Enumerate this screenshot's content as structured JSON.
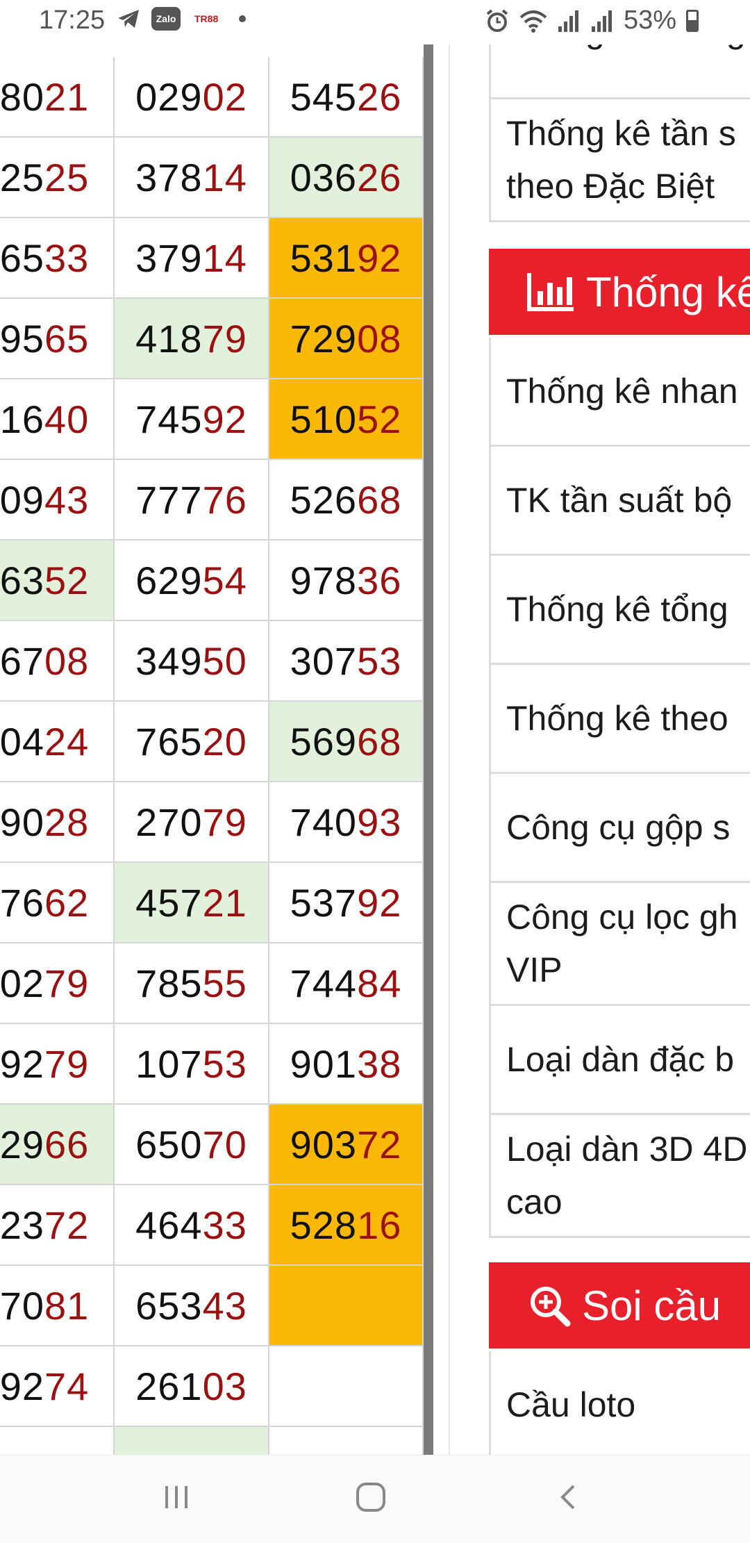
{
  "status_bar": {
    "time": "17:25",
    "left_icons": [
      "telegram-icon",
      "zalo-icon",
      "tr88-icon"
    ],
    "zalo_label": "Zalo",
    "tr88_label": "TR88",
    "battery": "53%"
  },
  "table": {
    "rows": [
      [
        {
          "head": "80",
          "tail": "21",
          "bg": ""
        },
        {
          "head": "029",
          "tail": "02",
          "bg": ""
        },
        {
          "head": "545",
          "tail": "26",
          "bg": ""
        }
      ],
      [
        {
          "head": "25",
          "tail": "25",
          "bg": ""
        },
        {
          "head": "378",
          "tail": "14",
          "bg": ""
        },
        {
          "head": "036",
          "tail": "26",
          "bg": "green"
        }
      ],
      [
        {
          "head": "65",
          "tail": "33",
          "bg": ""
        },
        {
          "head": "379",
          "tail": "14",
          "bg": ""
        },
        {
          "head": "531",
          "tail": "92",
          "bg": "orange"
        }
      ],
      [
        {
          "head": "95",
          "tail": "65",
          "bg": ""
        },
        {
          "head": "418",
          "tail": "79",
          "bg": "green"
        },
        {
          "head": "729",
          "tail": "08",
          "bg": "orange"
        }
      ],
      [
        {
          "head": "16",
          "tail": "40",
          "bg": ""
        },
        {
          "head": "745",
          "tail": "92",
          "bg": ""
        },
        {
          "head": "510",
          "tail": "52",
          "bg": "orange"
        }
      ],
      [
        {
          "head": "09",
          "tail": "43",
          "bg": ""
        },
        {
          "head": "777",
          "tail": "76",
          "bg": ""
        },
        {
          "head": "526",
          "tail": "68",
          "bg": ""
        }
      ],
      [
        {
          "head": "63",
          "tail": "52",
          "bg": "green"
        },
        {
          "head": "629",
          "tail": "54",
          "bg": ""
        },
        {
          "head": "978",
          "tail": "36",
          "bg": ""
        }
      ],
      [
        {
          "head": "67",
          "tail": "08",
          "bg": ""
        },
        {
          "head": "349",
          "tail": "50",
          "bg": ""
        },
        {
          "head": "307",
          "tail": "53",
          "bg": ""
        }
      ],
      [
        {
          "head": "04",
          "tail": "24",
          "bg": ""
        },
        {
          "head": "765",
          "tail": "20",
          "bg": ""
        },
        {
          "head": "569",
          "tail": "68",
          "bg": "green"
        }
      ],
      [
        {
          "head": "90",
          "tail": "28",
          "bg": ""
        },
        {
          "head": "270",
          "tail": "79",
          "bg": ""
        },
        {
          "head": "740",
          "tail": "93",
          "bg": ""
        }
      ],
      [
        {
          "head": "76",
          "tail": "62",
          "bg": ""
        },
        {
          "head": "457",
          "tail": "21",
          "bg": "green"
        },
        {
          "head": "537",
          "tail": "92",
          "bg": ""
        }
      ],
      [
        {
          "head": "02",
          "tail": "79",
          "bg": ""
        },
        {
          "head": "785",
          "tail": "55",
          "bg": ""
        },
        {
          "head": "744",
          "tail": "84",
          "bg": ""
        }
      ],
      [
        {
          "head": "92",
          "tail": "79",
          "bg": ""
        },
        {
          "head": "107",
          "tail": "53",
          "bg": ""
        },
        {
          "head": "901",
          "tail": "38",
          "bg": ""
        }
      ],
      [
        {
          "head": "29",
          "tail": "66",
          "bg": "green"
        },
        {
          "head": "650",
          "tail": "70",
          "bg": ""
        },
        {
          "head": "903",
          "tail": "72",
          "bg": "orange"
        }
      ],
      [
        {
          "head": "23",
          "tail": "72",
          "bg": ""
        },
        {
          "head": "464",
          "tail": "33",
          "bg": ""
        },
        {
          "head": "528",
          "tail": "16",
          "bg": "orange"
        }
      ],
      [
        {
          "head": "70",
          "tail": "81",
          "bg": ""
        },
        {
          "head": "653",
          "tail": "43",
          "bg": ""
        },
        {
          "head": "",
          "tail": "",
          "bg": "orange"
        }
      ],
      [
        {
          "head": "92",
          "tail": "74",
          "bg": ""
        },
        {
          "head": "261",
          "tail": "03",
          "bg": ""
        },
        {
          "head": "",
          "tail": "",
          "bg": ""
        }
      ],
      [
        {
          "head": "",
          "tail": "",
          "bg": ""
        },
        {
          "head": "",
          "tail": "",
          "bg": "green"
        },
        {
          "head": "",
          "tail": "",
          "bg": ""
        }
      ]
    ]
  },
  "sidebar": {
    "top_items": [
      {
        "lines": [
          "Thống kê loto g"
        ]
      },
      {
        "lines": [
          "Thống kê tần s",
          "theo Đặc Biệt"
        ]
      }
    ],
    "section_thongke": {
      "title": "Thống kê"
    },
    "thongke_items": [
      {
        "lines": [
          "Thống kê nhan"
        ]
      },
      {
        "lines": [
          "TK tần suất bộ"
        ]
      },
      {
        "lines": [
          "Thống kê tổng"
        ]
      },
      {
        "lines": [
          "Thống kê theo"
        ]
      },
      {
        "lines": [
          "Công cụ gộp s"
        ]
      },
      {
        "lines": [
          "Công cụ lọc gh",
          "VIP"
        ]
      },
      {
        "lines": [
          "Loại dàn đặc b"
        ]
      },
      {
        "lines": [
          "Loại dàn 3D 4D",
          "cao"
        ]
      }
    ],
    "section_soicau": {
      "title": "Soi cầu"
    },
    "soicau_items": [
      {
        "lines": [
          "Cầu loto"
        ]
      }
    ]
  },
  "nav_bar": [
    "recent-apps-icon",
    "home-icon",
    "back-icon"
  ],
  "colors": {
    "accent_red": "#e8202b",
    "tail_red": "#9b1010",
    "green_cell": "#e2f1dc",
    "orange_cell": "#fbb804"
  }
}
